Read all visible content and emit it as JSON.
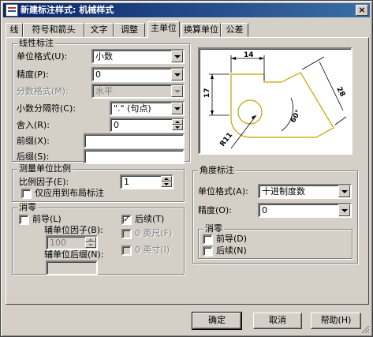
{
  "window": {
    "title": "新建标注样式: 机械样式"
  },
  "tabs": [
    {
      "label": "线"
    },
    {
      "label": "符号和箭头"
    },
    {
      "label": "文字"
    },
    {
      "label": "调整"
    },
    {
      "label": "主单位"
    },
    {
      "label": "换算单位"
    },
    {
      "label": "公差"
    }
  ],
  "linear": {
    "group_title": "线性标注",
    "unit_format_label": "单位格式(U):",
    "unit_format_value": "小数",
    "precision_label": "精度(P):",
    "precision_value": "0",
    "fraction_format_label": "分数格式(M):",
    "fraction_format_value": "水平",
    "decimal_sep_label": "小数分隔符(C):",
    "decimal_sep_value": "\".\" (句点)",
    "round_label": "舍入(R):",
    "round_value": "0",
    "prefix_label": "前缀(X):",
    "prefix_value": "",
    "suffix_label": "后缀(S):",
    "suffix_value": ""
  },
  "scale": {
    "group_title": "测量单位比例",
    "factor_label": "比例因子(E):",
    "factor_value": "1",
    "layout_only_label": "仅应用到布局标注"
  },
  "zero": {
    "group_title": "消零",
    "leading_label": "前导(L)",
    "trailing_label": "后续(T)",
    "sub_factor_label": "辅单位因子(B):",
    "sub_factor_value": "100",
    "sub_suffix_label": "辅单位后缀(N):",
    "sub_suffix_value": "",
    "feet_label": "0 英尺(F)",
    "inches_label": "0 英寸(I)",
    "check_mark": "✓"
  },
  "preview": {
    "dim_top": "14",
    "dim_left": "17",
    "dim_slant": "28",
    "dim_angle": "60°",
    "dim_radius": "R11"
  },
  "angular": {
    "group_title": "角度标注",
    "unit_format_label": "单位格式(A):",
    "unit_format_value": "十进制度数",
    "precision_label": "精度(O):",
    "precision_value": "0",
    "zero_title": "消零",
    "leading_label": "前导(D)",
    "trailing_label": "后续(N)"
  },
  "buttons": {
    "ok": "确定",
    "cancel": "取消",
    "help": "帮助(H)"
  },
  "title_close": "×",
  "colors": {
    "titlebar": "#0a246a",
    "face": "#d4d0c8",
    "preview_shape": "#c8a000"
  }
}
